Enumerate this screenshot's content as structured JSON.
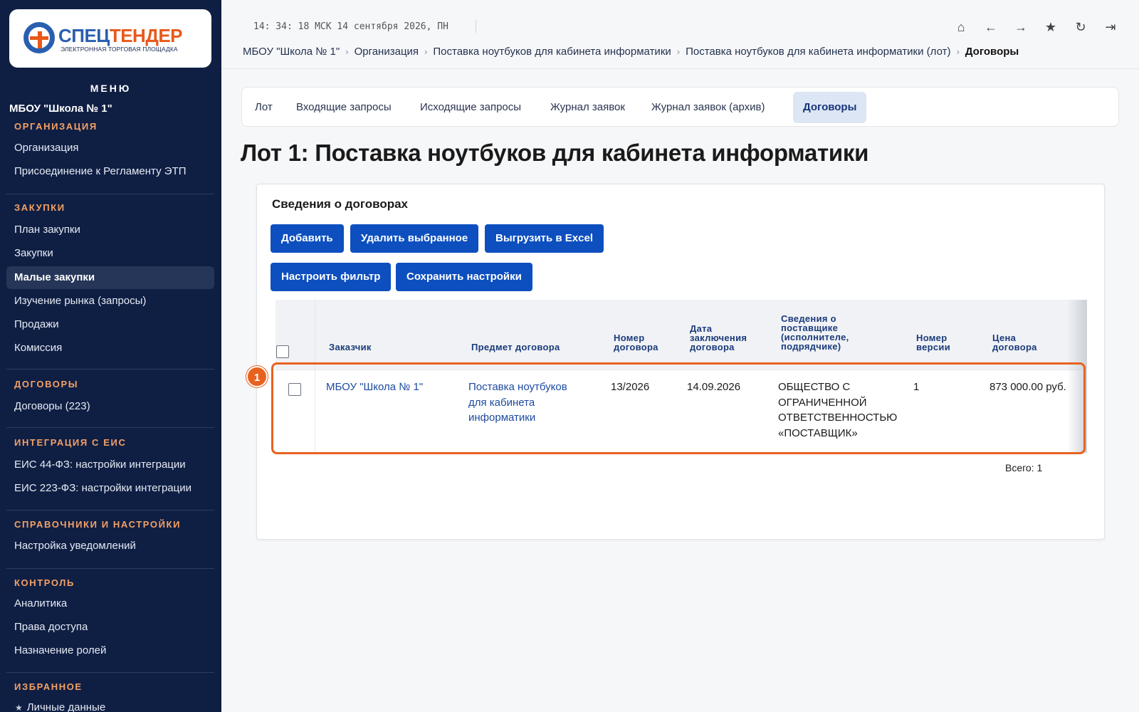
{
  "brand": {
    "name_part1": "СПЕЦ",
    "name_part2": "ТЕНДЕР",
    "subtitle": "ЭЛЕКТРОННАЯ ТОРГОВАЯ ПЛОЩАДКА",
    "colors": {
      "blue": "#2a5fb0",
      "orange": "#e8591a",
      "sidebar_bg": "#0f1f44",
      "accent_button": "#0d4fbf"
    }
  },
  "sidebar": {
    "menu_title": "МЕНЮ",
    "org_name": "МБОУ \"Школа № 1\"",
    "sections": [
      {
        "title": "ОРГАНИЗАЦИЯ",
        "items": [
          "Организация",
          "Присоединение к Регламенту ЭТП"
        ]
      },
      {
        "title": "ЗАКУПКИ",
        "items": [
          "План закупки",
          "Закупки",
          "Малые закупки",
          "Изучение рынка (запросы)",
          "Продажи",
          "Комиссия"
        ]
      },
      {
        "title": "ДОГОВОРЫ",
        "items": [
          "Договоры (223)"
        ]
      },
      {
        "title": "ИНТЕГРАЦИЯ С ЕИС",
        "items": [
          "ЕИС 44-ФЗ: настройки интеграции",
          "ЕИС 223-ФЗ: настройки интеграции"
        ]
      },
      {
        "title": "СПРАВОЧНИКИ И НАСТРОЙКИ",
        "items": [
          "Настройка уведомлений"
        ]
      },
      {
        "title": "КОНТРОЛЬ",
        "items": [
          "Аналитика",
          "Права доступа",
          "Назначение ролей"
        ]
      },
      {
        "title": "ИЗБРАННОЕ",
        "items": [
          "Личные данные"
        ]
      }
    ],
    "active_item": "Малые закупки"
  },
  "topbar": {
    "clock": "14: 34: 18 МСК  14 сентября 2026, ПН",
    "icons": [
      "home-icon",
      "back-arrow-icon",
      "forward-arrow-icon",
      "star-icon",
      "refresh-icon",
      "logout-icon"
    ]
  },
  "breadcrumbs": [
    "МБОУ \"Школа № 1\"",
    "Организация",
    "Поставка ноутбуков для кабинета информатики",
    "Поставка ноутбуков для кабинета информатики (лот)",
    "Договоры"
  ],
  "tabs": [
    "Лот",
    "Входящие запросы",
    "Исходящие запросы",
    "Журнал заявок",
    "Журнал заявок (архив)",
    "Договоры"
  ],
  "active_tab": "Договоры",
  "page_title": "Лот 1: Поставка ноутбуков для кабинета информатики",
  "card": {
    "title": "Сведения о договорах",
    "buttons": {
      "add": "Добавить",
      "delete_selected": "Удалить выбранное",
      "export_excel": "Выгрузить в Excel",
      "set_filter": "Настроить фильтр",
      "save_settings": "Сохранить настройки"
    },
    "table": {
      "columns": {
        "customer": "Заказчик",
        "subject": "Предмет договора",
        "number": "Номер\nдоговора",
        "date": "Дата\nзаключения\nдоговора",
        "supplier": "Сведения о\nпоставщике\n(исполнителе,\nподрядчике)",
        "version": "Номер\nверсии",
        "price": "Цена\nдоговора"
      },
      "rows": [
        {
          "customer": "МБОУ \"Школа № 1\"",
          "subject": "Поставка ноутбуков\nдля кабинета\nинформатики",
          "number": "13/2026",
          "date": "14.09.2026",
          "supplier": "ОБЩЕСТВО С\nОГРАНИЧЕННОЙ\nОТВЕТСТВЕННОСТЬЮ\n«ПОСТАВЩИК»",
          "version": "1",
          "price": "873 000.00 руб."
        }
      ],
      "total": "Всего: 1"
    }
  },
  "annotation": {
    "marker": "1",
    "color": "#e8621f"
  }
}
